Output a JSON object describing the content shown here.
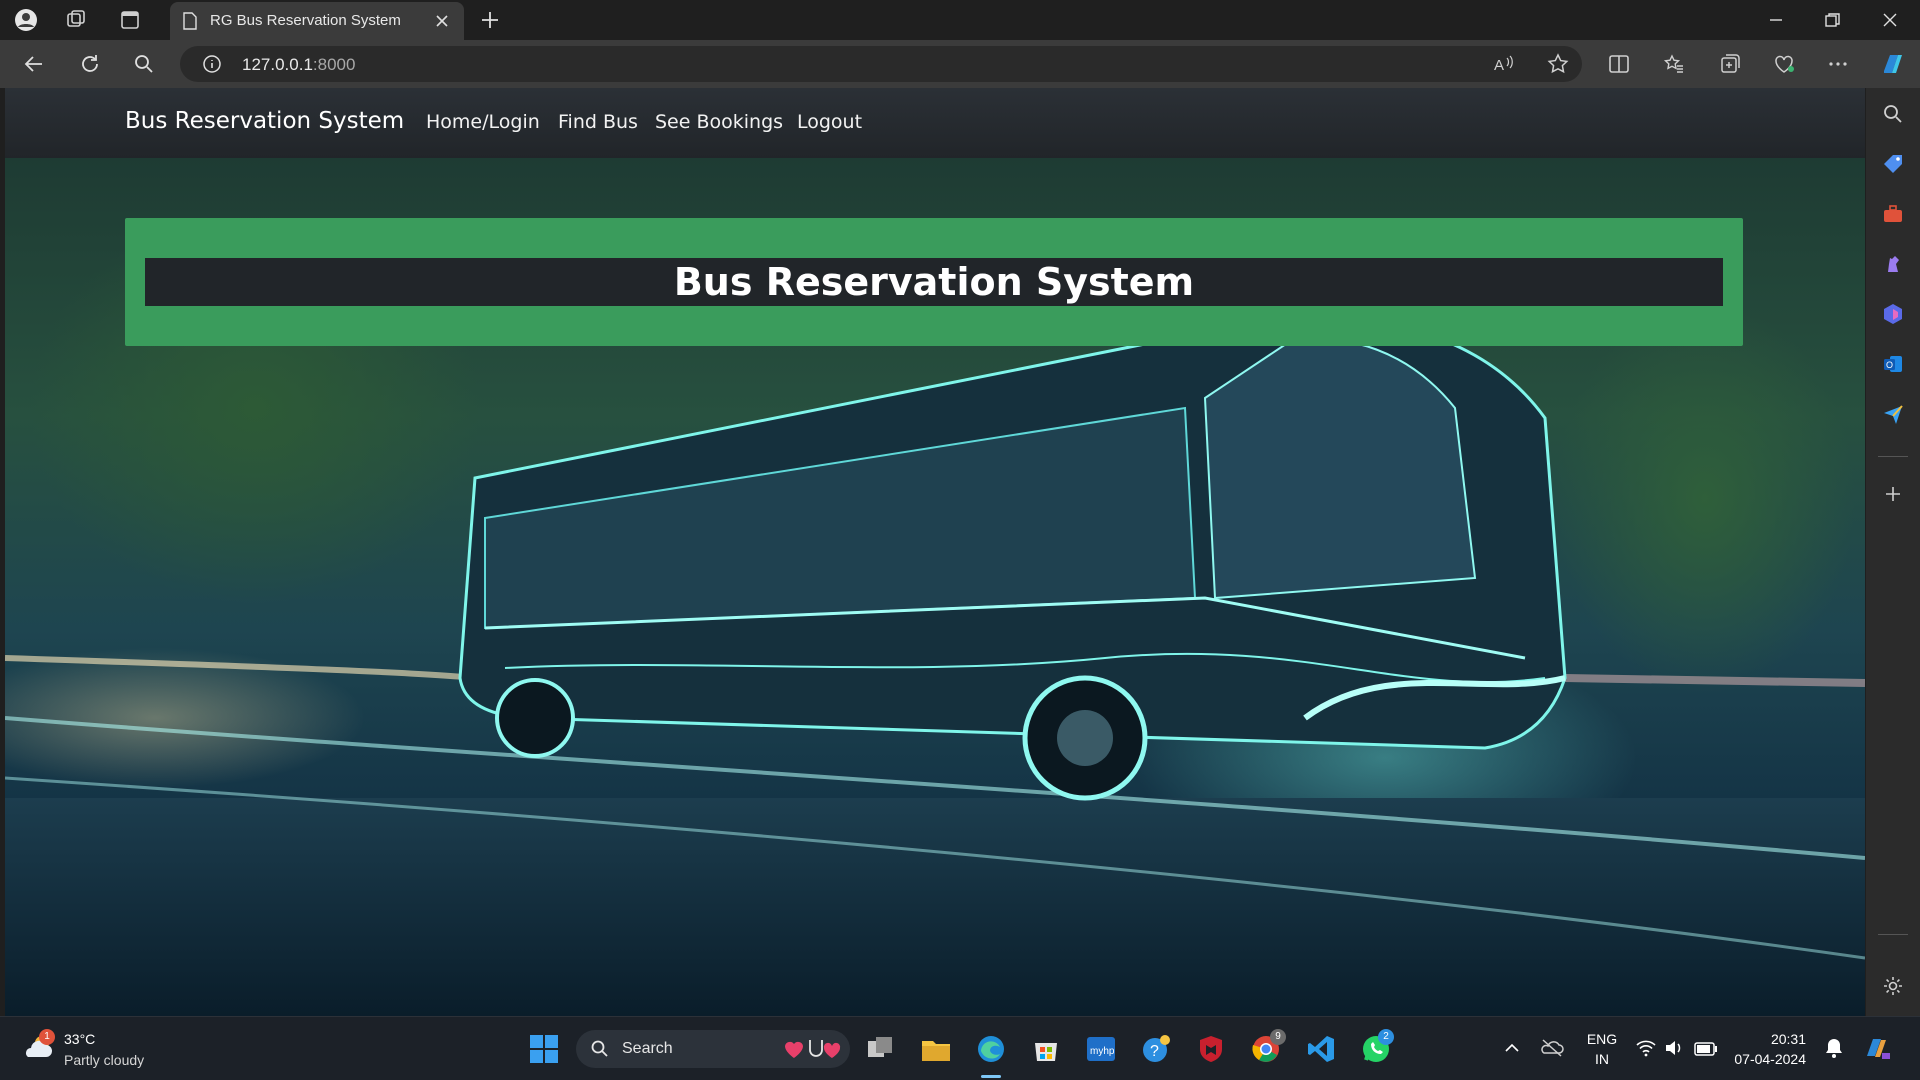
{
  "browser": {
    "tab_title": "RG Bus Reservation System",
    "url_host": "127.0.0.1",
    "url_port": ":8000"
  },
  "navbar": {
    "brand": "Bus Reservation System",
    "links": [
      "Home/Login",
      "Find Bus",
      "See Bookings",
      "Logout"
    ]
  },
  "hero": {
    "title": "Bus Reservation System"
  },
  "taskbar": {
    "weather_temp": "33°C",
    "weather_desc": "Partly cloudy",
    "weather_badge": "1",
    "search_label": "Search",
    "chrome_badge": "9",
    "whatsapp_badge": "2",
    "lang_line1": "ENG",
    "lang_line2": "IN",
    "time": "20:31",
    "date": "07-04-2024"
  },
  "colors": {
    "banner_green": "#3a9c5c",
    "banner_dark": "#212529",
    "navbar": "#212529"
  }
}
